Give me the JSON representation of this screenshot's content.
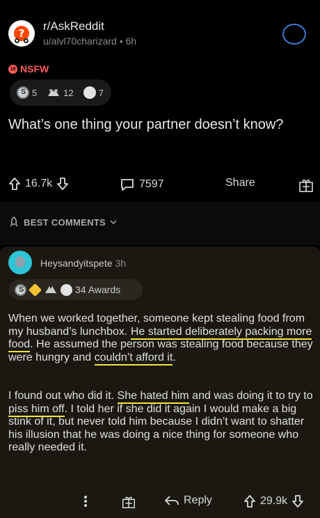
{
  "post": {
    "subreddit": "r/AskReddit",
    "user": "u/alvl70charizard",
    "age": "6h",
    "nsfw_label": "NSFW",
    "awards": [
      {
        "icon": "silver-award-icon",
        "count": "5"
      },
      {
        "icon": "wholesome-hands-award-icon",
        "count": "12"
      },
      {
        "icon": "face-award-icon",
        "count": "7"
      }
    ],
    "title": "What’s one thing your partner doesn’t know?",
    "upvotes": "16.7k",
    "comments": "7597",
    "share_label": "Share"
  },
  "sort": {
    "label": "BEST COMMENTS"
  },
  "comment": {
    "author": "Heysandyitspete",
    "age": "3h",
    "awards_label": "34 Awards",
    "p1_a": "When we worked together, someone kept stealing food from my husband’s lunchbox. ",
    "p1_h1": "He started deliberately packing more food",
    "p1_b": ". He assumed the person was stealing food because they were hungry and ",
    "p1_h2": "couldn’t afford it",
    "p1_c": ".",
    "p2_a": "I found out who did it. ",
    "p2_h1": "She hated him",
    "p2_b": " and was doing it to try to ",
    "p2_h2": "piss him off",
    "p2_c": ". I told her if she did it again I would make a big stink of it, but never told him because I didn’t want to shatter his illusion that he was doing a nice thing for someone who really needed it.",
    "reply_label": "Reply",
    "upvotes": "29.9k"
  },
  "colors": {
    "highlight": "#f5e63a",
    "nsfw": "#ff5a5a",
    "join": "#3a7bd5"
  }
}
